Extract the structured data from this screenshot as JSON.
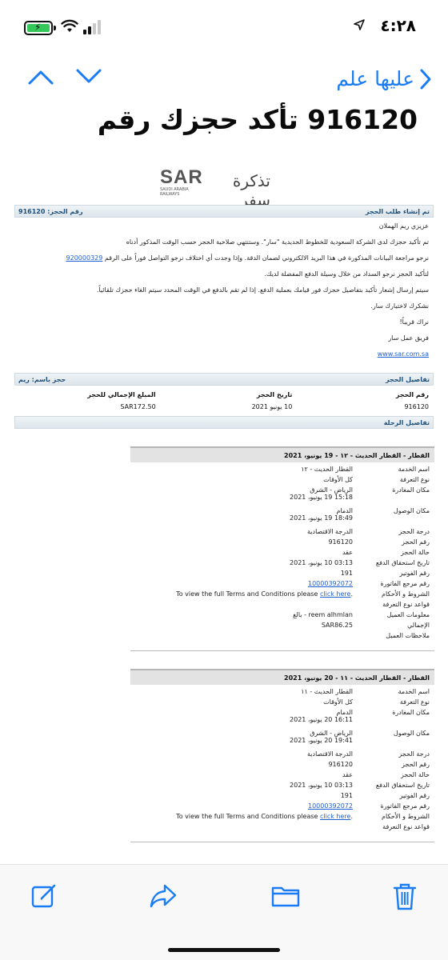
{
  "status_bar": {
    "time": "٤:٢٨"
  },
  "nav": {
    "back_label": "عليها علم"
  },
  "email": {
    "subject": "916120  تأكد حجزك رقم",
    "logo_text": "SAR",
    "logo_sub": "SAUDI ARABIA RAILWAYS",
    "logo_ticket": "تذكرة سفر",
    "header_bar": {
      "right": "تم إنشاء طلب الحجز",
      "left": "رقم الحجز: 916120"
    },
    "greeting": "عزيزي ريم الهملان",
    "p1": "تم تأكيد حجزك لدى الشركة السعودية للخطوط الحديدية \"سار\". وستنتهي صلاحية الحجز حسب الوقت المذكور أدناه",
    "p2": "نرجو مراجعة البيانات المذكورة في هذا البريد الالكتروني لضمان الدقة. وإذا وجدت أي اختلاف نرجو التواصل فوراً على  الرقم",
    "p2_phone": "920000329",
    "p3": "لتأكيد الحجز نرجو السداد من خلال وسيلة الدفع المفضلة لديك.",
    "p4": "سيتم إرسال إشعار تأكيد بتفاصيل حجزك فور قيامك بعملية الدفع. إذا لم تقم بالدفع في الوقت المحدد سيتم الغاء حجزك تلقائياً.",
    "p5": "نشكرك لاختيارك سار.",
    "p6": "نراك قريباً!",
    "p7": "فريق عمل سار",
    "website": "www.sar.com.sa",
    "details_bar": {
      "right": "تفاصيل الحجز",
      "left": "حجز باسم: ريم"
    },
    "booking_table": {
      "headers": [
        "رقم الحجز",
        "تاريخ الحجز",
        "المبلغ الإجمالي للحجز"
      ],
      "values": [
        "916120",
        "10 يونيو 2021",
        "SAR172.50"
      ]
    },
    "trip_bar": "تفاصيل الرحلة",
    "trips": [
      {
        "title": "القطار - القطار الحديث - ١٢ - 19 يونيو، 2021",
        "rows": [
          {
            "k": "اسم الخدمة",
            "v": "القطار الحديث - ١٢"
          },
          {
            "k": "نوع التعرفة",
            "v": "كل الأوقات"
          },
          {
            "k": "مكان المغادرة",
            "v": "الرياض - الشرق",
            "v2": "15:18 19 يونيو، 2021"
          },
          {
            "k": "مكان الوصول",
            "v": "الدمام",
            "v2": "18:49 19 يونيو، 2021"
          },
          {
            "k": "درجة الحجز",
            "v": "الدرجة الاقتصادية"
          },
          {
            "k": "رقم الحجز",
            "v": "916120"
          },
          {
            "k": "حالة الحجز",
            "v": "عقد"
          },
          {
            "k": "تاريخ استحقاق الدفع",
            "v": "03:13 10 يونيو، 2021"
          },
          {
            "k": "رقم الفوتير",
            "v": "191"
          },
          {
            "k": "رقم مرجع الفاتورة",
            "v": "10000392072",
            "link": true
          },
          {
            "k": "الشروط و الأحكام",
            "v": "To view the full Terms and Conditions please ",
            "v_link": "click here"
          },
          {
            "k": "قواعد نوع التعرفة",
            "v": ""
          },
          {
            "k": "معلومات العميل",
            "v": "reem alhmlan - بالغ"
          },
          {
            "k": "الإجمالي",
            "v": "SAR86.25"
          },
          {
            "k": "ملاحظات العميل",
            "v": ""
          }
        ]
      },
      {
        "title": "القطار - القطار الحديث - ١١ - 20 يونيو، 2021",
        "rows": [
          {
            "k": "اسم الخدمة",
            "v": "القطار الحديث - ١١"
          },
          {
            "k": "نوع التعرفة",
            "v": "كل الأوقات"
          },
          {
            "k": "مكان المغادرة",
            "v": "الدمام",
            "v2": "16:11 20 يونيو، 2021"
          },
          {
            "k": "مكان الوصول",
            "v": "الرياض - الشرق",
            "v2": "19:41 20 يونيو، 2021"
          },
          {
            "k": "درجة الحجز",
            "v": "الدرجة الاقتصادية"
          },
          {
            "k": "رقم الحجز",
            "v": "916120"
          },
          {
            "k": "حالة الحجز",
            "v": "عقد"
          },
          {
            "k": "تاريخ استحقاق الدفع",
            "v": "03:13 10 يونيو، 2021"
          },
          {
            "k": "رقم الفوتير",
            "v": "191"
          },
          {
            "k": "رقم مرجع الفاتورة",
            "v": "10000392072",
            "link": true
          },
          {
            "k": "الشروط و الأحكام",
            "v": "To view the full Terms and Conditions please ",
            "v_link": "click here"
          },
          {
            "k": "قواعد نوع التعرفة",
            "v": ""
          }
        ]
      }
    ]
  },
  "toolbar": {
    "icons": [
      "compose-icon",
      "forward-icon",
      "folder-icon",
      "trash-icon"
    ]
  },
  "colors": {
    "accent": "#1a7cf5",
    "battery": "#35c759",
    "header_text": "#1d4f7a"
  }
}
